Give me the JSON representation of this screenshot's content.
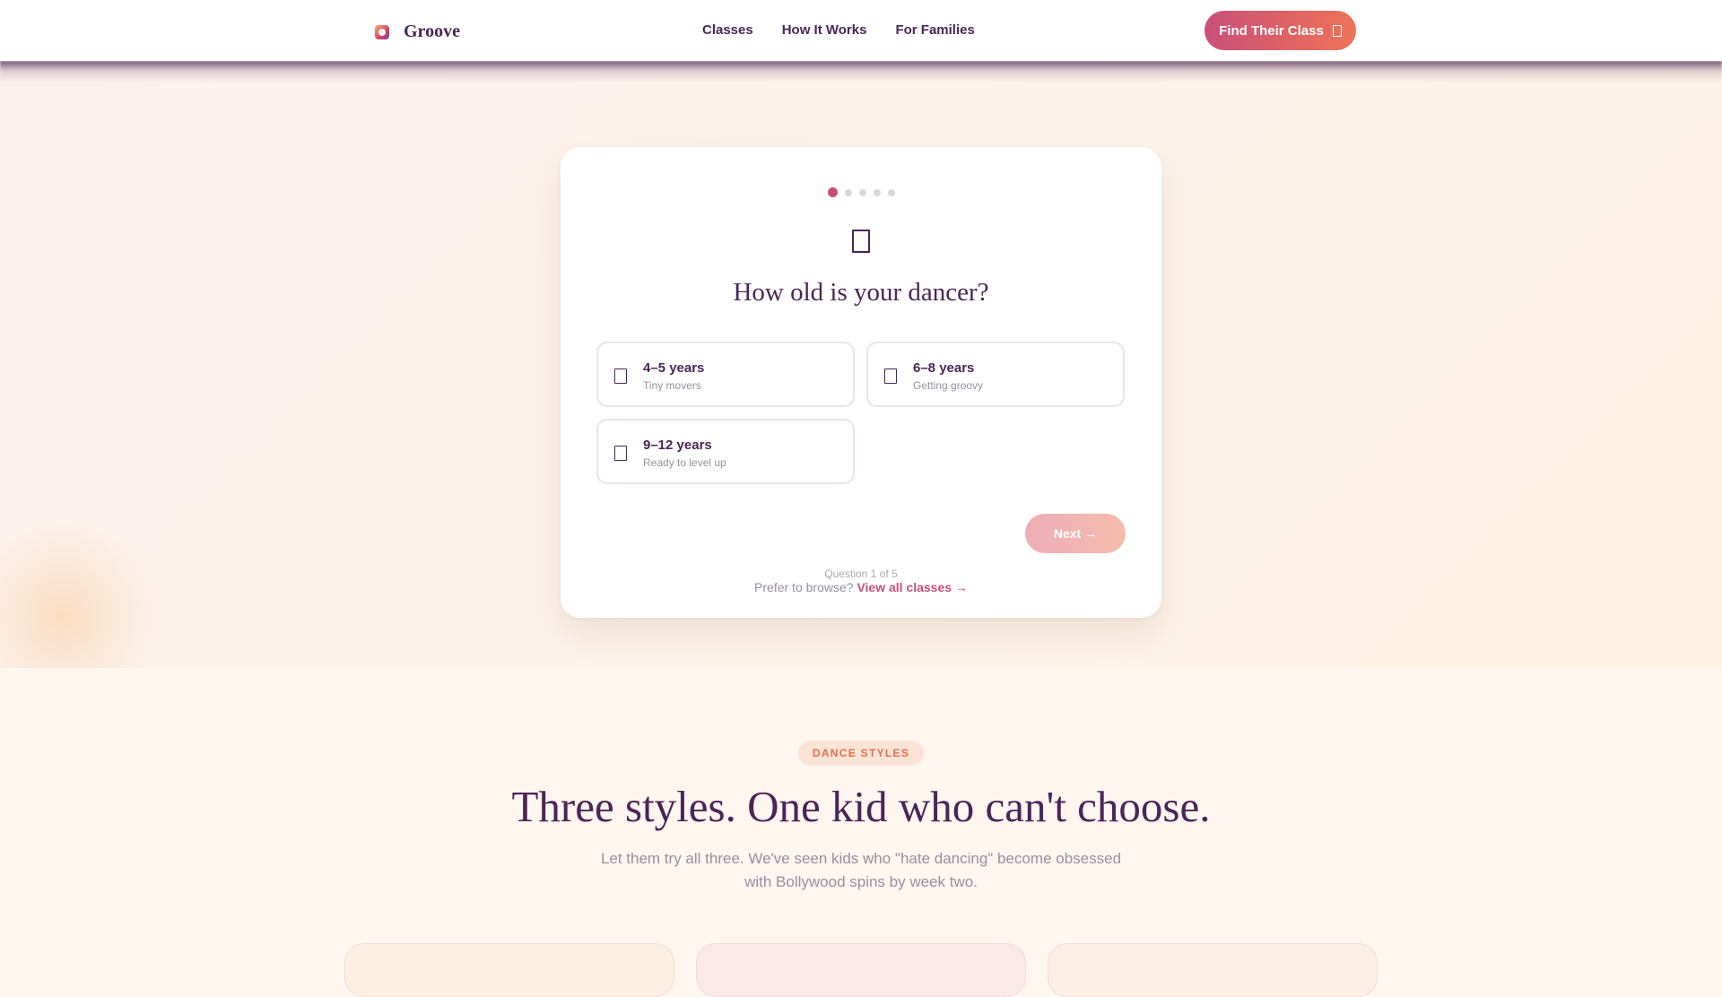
{
  "header": {
    "logo_text": "Groove",
    "nav": [
      "Classes",
      "How It Works",
      "For Families"
    ],
    "cta_label": "Find Their Class"
  },
  "quiz": {
    "progress": {
      "current": 1,
      "total": 5
    },
    "title": "How old is your dancer?",
    "options": [
      {
        "label": "4–5 years",
        "sub": "Tiny movers"
      },
      {
        "label": "6–8 years",
        "sub": "Getting groovy"
      },
      {
        "label": "9–12 years",
        "sub": "Ready to level up"
      }
    ],
    "next_label": "Next →",
    "counter": "Question 1 of 5"
  },
  "browse": {
    "prompt": "Prefer to browse?",
    "link": "View all classes →"
  },
  "styles": {
    "eyebrow": "DANCE STYLES",
    "title": "Three styles. One kid who can't choose.",
    "subtitle": "Let them try all three. We've seen kids who \"hate dancing\" become obsessed with Bollywood spins by week two."
  },
  "colors": {
    "brand_pink": "#c94f78",
    "brand_orange": "#ef7357",
    "ink": "#4a2557"
  },
  "icons": [
    "logo-icon",
    "class-icon",
    "question-icon",
    "option-icon"
  ]
}
